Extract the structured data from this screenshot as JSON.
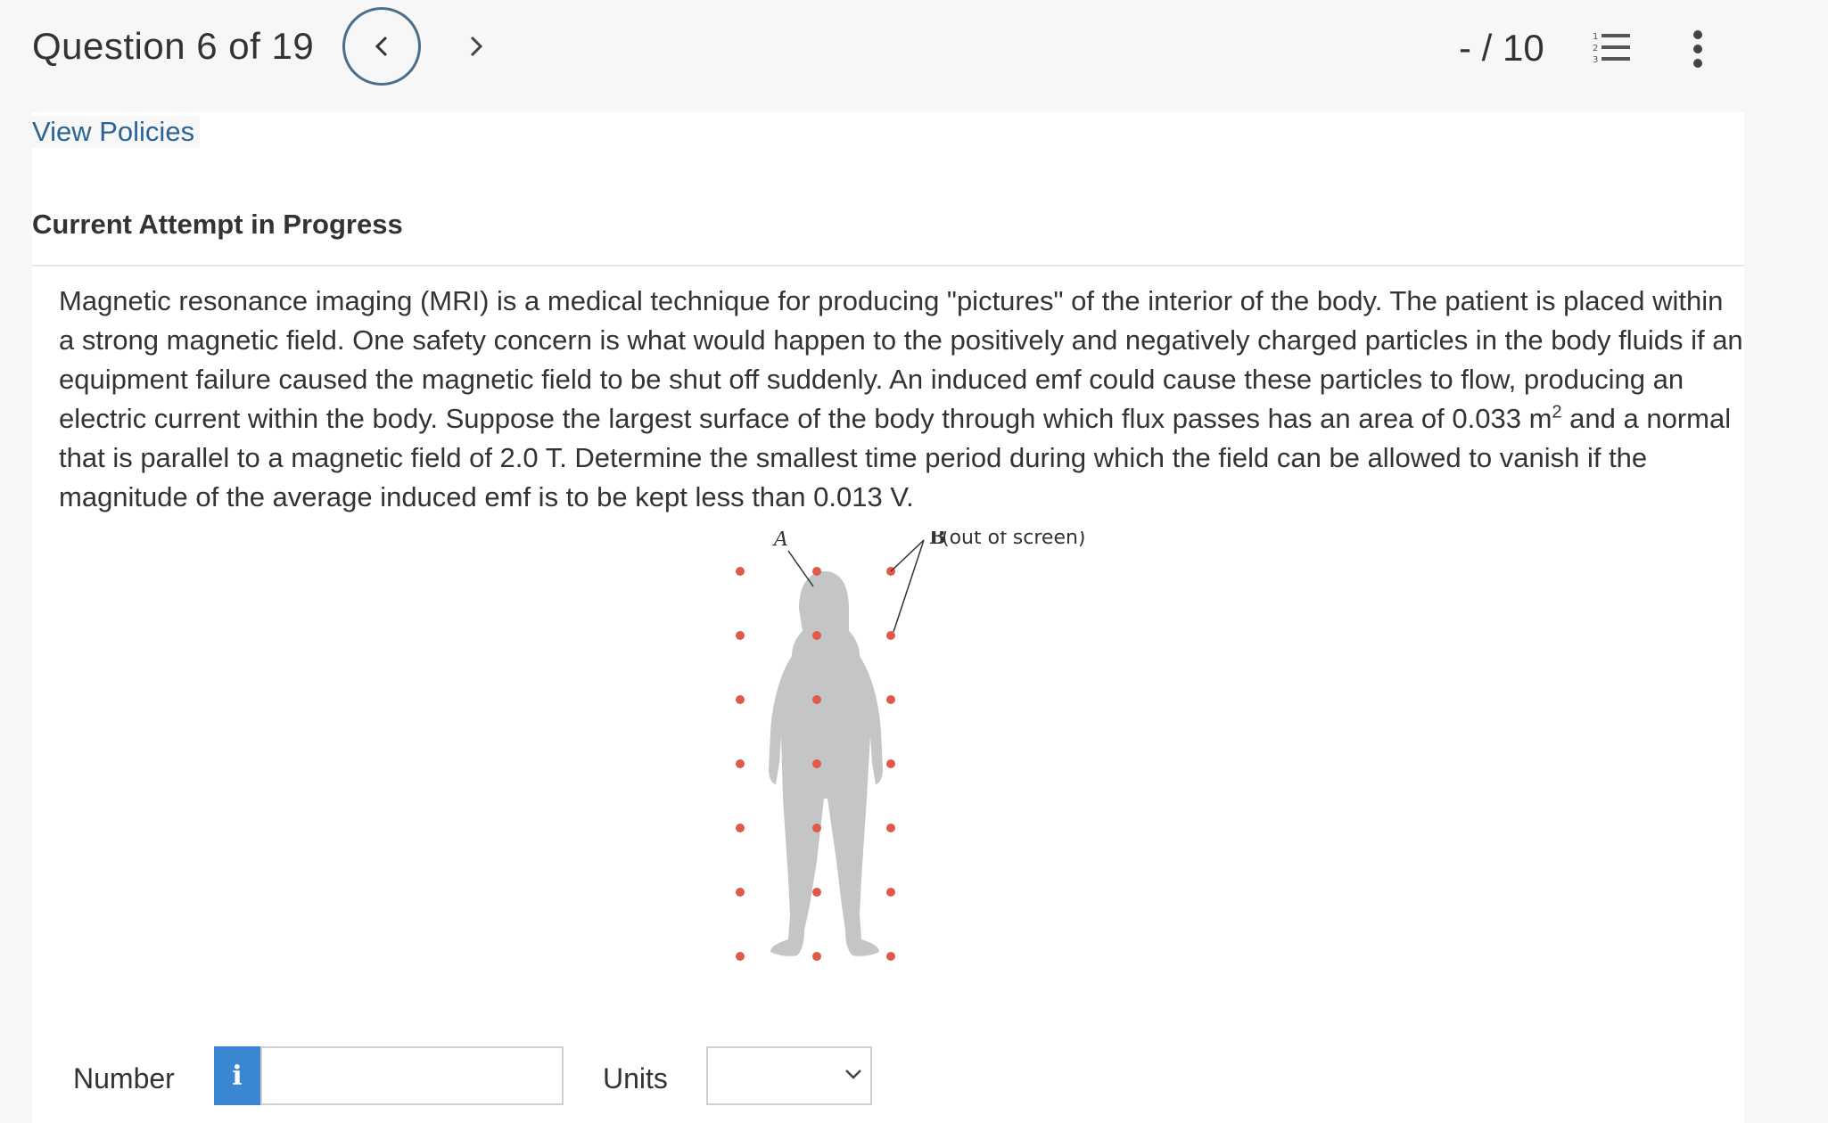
{
  "header": {
    "question_counter": "Question 6 of 19",
    "prev_icon": "chevron-left-icon",
    "next_icon": "chevron-right-icon",
    "score": "- / 10",
    "question_list_icon": "numbered-list-icon",
    "more_icon": "vertical-ellipsis-icon"
  },
  "links": {
    "view_policies": "View Policies"
  },
  "status": {
    "attempt": "Current Attempt in Progress"
  },
  "question": {
    "text_part1": "Magnetic resonance imaging (MRI) is a medical technique for producing \"pictures\" of the interior of the body. The patient is placed within a strong magnetic field. One safety concern is what would happen to the positively and negatively charged particles in the body fluids if an equipment failure caused the magnetic field to be shut off suddenly. An induced emf could cause these particles to flow, producing an electric current within the body. Suppose the largest surface of the body through which flux passes has an area of 0.033 m",
    "superscript": "2",
    "text_part2": " and a normal that is parallel to a magnetic field of 2.0 T. Determine the smallest time period during which the field can be allowed to vanish if the magnitude of the average induced emf is to be kept less than 0.013 V."
  },
  "figure": {
    "label_area": "A",
    "label_b_symbol": "B",
    "label_b_text": " (out of screen)",
    "dot_color": "#e05a47",
    "silhouette_color": "#c4c5c7"
  },
  "answer": {
    "number_label": "Number",
    "info_symbol": "i",
    "number_value": "",
    "units_label": "Units",
    "units_selected": ""
  },
  "colors": {
    "link": "#2a6496",
    "info_button": "#3a86d1",
    "nav_ring": "#4a6f8a"
  }
}
